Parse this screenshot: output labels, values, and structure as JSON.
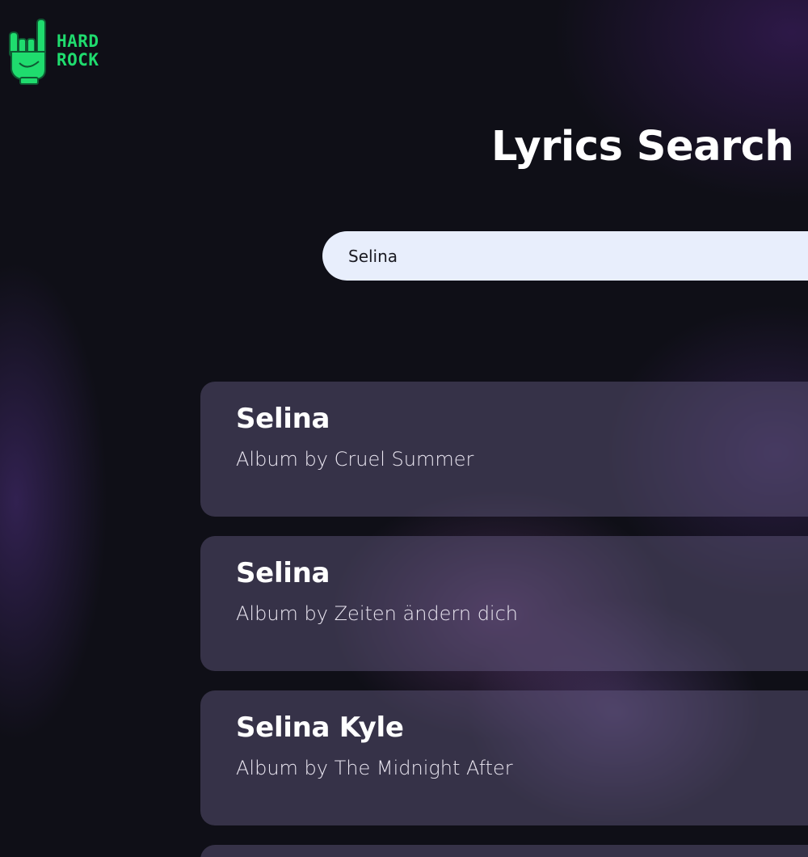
{
  "logo": {
    "line1": "HARD",
    "line2": "ROCK",
    "icon": "rock-hand-icon",
    "color": "#1fdc6e"
  },
  "header": {
    "title": "Lyrics Search"
  },
  "search": {
    "value": "Selina"
  },
  "results": [
    {
      "title": "Selina",
      "subtitle": "Album by Cruel Summer"
    },
    {
      "title": "Selina",
      "subtitle": "Album by Zeiten ändern dich"
    },
    {
      "title": "Selina Kyle",
      "subtitle": "Album by The Midnight After"
    }
  ]
}
